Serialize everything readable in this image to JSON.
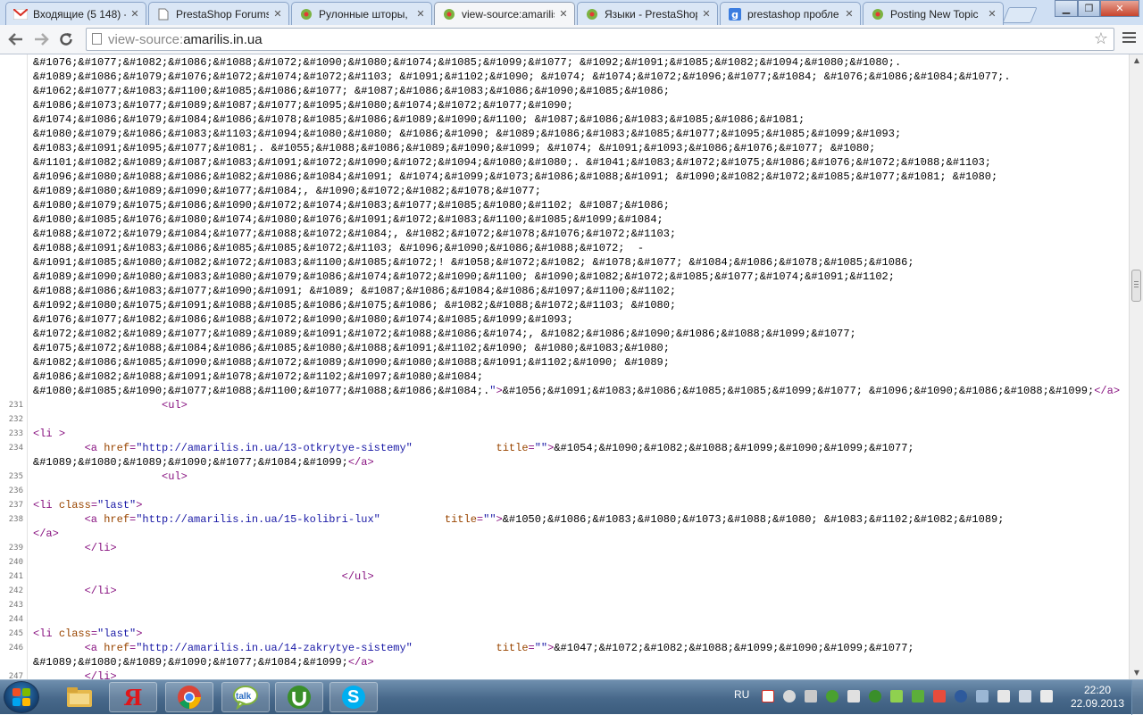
{
  "tabs": [
    {
      "title": "Входящие (5 148) -",
      "icon": "gmail-icon",
      "active": false
    },
    {
      "title": "PrestaShop Forums",
      "icon": "page-icon",
      "active": false
    },
    {
      "title": "Рулонные шторы,",
      "icon": "shop-icon",
      "active": false
    },
    {
      "title": "view-source:amarilis",
      "icon": "page-icon",
      "active": true
    },
    {
      "title": "Языки - PrestaShop",
      "icon": "shop-icon",
      "active": false
    },
    {
      "title": "prestashop пробле",
      "icon": "google-icon",
      "active": false
    },
    {
      "title": "Posting New Topic",
      "icon": "shop-icon",
      "active": false
    }
  ],
  "omnibox": {
    "prefix": "view-source:",
    "host": "amarilis.in.ua"
  },
  "source": {
    "lines": [
      {
        "n": "",
        "parts": [
          {
            "c": "e",
            "t": "&#1076;&#1077;&#1082;&#1086;&#1088;&#1072;&#1090;&#1080;&#1074;&#1085;&#1099;&#1077; &#1092;&#1091;&#1085;&#1082;&#1094;&#1080;&#1080;."
          }
        ]
      },
      {
        "n": "",
        "parts": [
          {
            "c": "e",
            "t": "&#1089;&#1086;&#1079;&#1076;&#1072;&#1074;&#1072;&#1103; &#1091;&#1102;&#1090; &#1074; &#1074;&#1072;&#1096;&#1077;&#1084; &#1076;&#1086;&#1084;&#1077;."
          }
        ]
      },
      {
        "n": "",
        "parts": [
          {
            "c": "e",
            "t": "&#1062;&#1077;&#1083;&#1100;&#1085;&#1086;&#1077; &#1087;&#1086;&#1083;&#1086;&#1090;&#1085;&#1086;"
          }
        ]
      },
      {
        "n": "",
        "parts": [
          {
            "c": "e",
            "t": "&#1086;&#1073;&#1077;&#1089;&#1087;&#1077;&#1095;&#1080;&#1074;&#1072;&#1077;&#1090;"
          }
        ]
      },
      {
        "n": "",
        "parts": [
          {
            "c": "e",
            "t": "&#1074;&#1086;&#1079;&#1084;&#1086;&#1078;&#1085;&#1086;&#1089;&#1090;&#1100; &#1087;&#1086;&#1083;&#1085;&#1086;&#1081;"
          }
        ]
      },
      {
        "n": "",
        "parts": [
          {
            "c": "e",
            "t": "&#1080;&#1079;&#1086;&#1083;&#1103;&#1094;&#1080;&#1080; &#1086;&#1090; &#1089;&#1086;&#1083;&#1085;&#1077;&#1095;&#1085;&#1099;&#1093;"
          }
        ]
      },
      {
        "n": "",
        "parts": [
          {
            "c": "e",
            "t": "&#1083;&#1091;&#1095;&#1077;&#1081;. &#1055;&#1088;&#1086;&#1089;&#1090;&#1099; &#1074; &#1091;&#1093;&#1086;&#1076;&#1077; &#1080;"
          }
        ]
      },
      {
        "n": "",
        "parts": [
          {
            "c": "e",
            "t": "&#1101;&#1082;&#1089;&#1087;&#1083;&#1091;&#1072;&#1090;&#1072;&#1094;&#1080;&#1080;. &#1041;&#1083;&#1072;&#1075;&#1086;&#1076;&#1072;&#1088;&#1103;"
          }
        ]
      },
      {
        "n": "",
        "parts": [
          {
            "c": "e",
            "t": "&#1096;&#1080;&#1088;&#1086;&#1082;&#1086;&#1084;&#1091; &#1074;&#1099;&#1073;&#1086;&#1088;&#1091; &#1090;&#1082;&#1072;&#1085;&#1077;&#1081; &#1080;"
          }
        ]
      },
      {
        "n": "",
        "parts": [
          {
            "c": "e",
            "t": "&#1089;&#1080;&#1089;&#1090;&#1077;&#1084;, &#1090;&#1072;&#1082;&#1078;&#1077;"
          }
        ]
      },
      {
        "n": "",
        "parts": [
          {
            "c": "e",
            "t": "&#1080;&#1079;&#1075;&#1086;&#1090;&#1072;&#1074;&#1083;&#1077;&#1085;&#1080;&#1102; &#1087;&#1086;"
          }
        ]
      },
      {
        "n": "",
        "parts": [
          {
            "c": "e",
            "t": "&#1080;&#1085;&#1076;&#1080;&#1074;&#1080;&#1076;&#1091;&#1072;&#1083;&#1100;&#1085;&#1099;&#1084;"
          }
        ]
      },
      {
        "n": "",
        "parts": [
          {
            "c": "e",
            "t": "&#1088;&#1072;&#1079;&#1084;&#1077;&#1088;&#1072;&#1084;, &#1082;&#1072;&#1078;&#1076;&#1072;&#1103;"
          }
        ]
      },
      {
        "n": "",
        "parts": [
          {
            "c": "e",
            "t": "&#1088;&#1091;&#1083;&#1086;&#1085;&#1085;&#1072;&#1103; &#1096;&#1090;&#1086;&#1088;&#1072;  -"
          }
        ]
      },
      {
        "n": "",
        "parts": [
          {
            "c": "e",
            "t": "&#1091;&#1085;&#1080;&#1082;&#1072;&#1083;&#1100;&#1085;&#1072;! &#1058;&#1072;&#1082; &#1078;&#1077; &#1084;&#1086;&#1078;&#1085;&#1086;"
          }
        ]
      },
      {
        "n": "",
        "parts": [
          {
            "c": "e",
            "t": "&#1089;&#1090;&#1080;&#1083;&#1080;&#1079;&#1086;&#1074;&#1072;&#1090;&#1100; &#1090;&#1082;&#1072;&#1085;&#1077;&#1074;&#1091;&#1102;"
          }
        ]
      },
      {
        "n": "",
        "parts": [
          {
            "c": "e",
            "t": "&#1088;&#1086;&#1083;&#1077;&#1090;&#1091; &#1089; &#1087;&#1086;&#1084;&#1086;&#1097;&#1100;&#1102;"
          }
        ]
      },
      {
        "n": "",
        "parts": [
          {
            "c": "e",
            "t": "&#1092;&#1080;&#1075;&#1091;&#1088;&#1085;&#1086;&#1075;&#1086; &#1082;&#1088;&#1072;&#1103; &#1080;"
          }
        ]
      },
      {
        "n": "",
        "parts": [
          {
            "c": "e",
            "t": "&#1076;&#1077;&#1082;&#1086;&#1088;&#1072;&#1090;&#1080;&#1074;&#1085;&#1099;&#1093;"
          }
        ]
      },
      {
        "n": "",
        "parts": [
          {
            "c": "e",
            "t": "&#1072;&#1082;&#1089;&#1077;&#1089;&#1089;&#1091;&#1072;&#1088;&#1086;&#1074;, &#1082;&#1086;&#1090;&#1086;&#1088;&#1099;&#1077;"
          }
        ]
      },
      {
        "n": "",
        "parts": [
          {
            "c": "e",
            "t": "&#1075;&#1072;&#1088;&#1084;&#1086;&#1085;&#1080;&#1088;&#1091;&#1102;&#1090; &#1080;&#1083;&#1080;"
          }
        ]
      },
      {
        "n": "",
        "parts": [
          {
            "c": "e",
            "t": "&#1082;&#1086;&#1085;&#1090;&#1088;&#1072;&#1089;&#1090;&#1080;&#1088;&#1091;&#1102;&#1090; &#1089;"
          }
        ]
      },
      {
        "n": "",
        "parts": [
          {
            "c": "e",
            "t": "&#1086;&#1082;&#1088;&#1091;&#1078;&#1072;&#1102;&#1097;&#1080;&#1084;"
          }
        ]
      },
      {
        "n": "",
        "parts": [
          {
            "c": "e",
            "t": "&#1080;&#1085;&#1090;&#1077;&#1088;&#1100;&#1077;&#1088;&#1086;&#1084;."
          },
          {
            "c": "v",
            "t": "\""
          },
          {
            "c": "t",
            "t": ">"
          },
          {
            "c": "e",
            "t": "&#1056;&#1091;&#1083;&#1086;&#1085;&#1085;&#1099;&#1077; &#1096;&#1090;&#1086;&#1088;&#1099;"
          },
          {
            "c": "t",
            "t": "</a>"
          }
        ]
      },
      {
        "n": "231",
        "parts": [
          {
            "c": "e",
            "t": "                    "
          },
          {
            "c": "t",
            "t": "<ul>"
          }
        ]
      },
      {
        "n": "232",
        "parts": []
      },
      {
        "n": "233",
        "parts": [
          {
            "c": "t",
            "t": "<li "
          },
          {
            "c": "t",
            "t": ">"
          }
        ]
      },
      {
        "n": "234",
        "parts": [
          {
            "c": "e",
            "t": "        "
          },
          {
            "c": "t",
            "t": "<a "
          },
          {
            "c": "a",
            "t": "href"
          },
          {
            "c": "t",
            "t": "="
          },
          {
            "c": "v",
            "t": "\"http://amarilis.in.ua/13-otkrytye-sistemy\""
          },
          {
            "c": "e",
            "t": "             "
          },
          {
            "c": "a",
            "t": "title"
          },
          {
            "c": "t",
            "t": "="
          },
          {
            "c": "v",
            "t": "\"\""
          },
          {
            "c": "t",
            "t": ">"
          },
          {
            "c": "e",
            "t": "&#1054;&#1090;&#1082;&#1088;&#1099;&#1090;&#1099;&#1077;"
          }
        ]
      },
      {
        "n": "",
        "parts": [
          {
            "c": "e",
            "t": "&#1089;&#1080;&#1089;&#1090;&#1077;&#1084;&#1099;"
          },
          {
            "c": "t",
            "t": "</a>"
          }
        ]
      },
      {
        "n": "235",
        "parts": [
          {
            "c": "e",
            "t": "                    "
          },
          {
            "c": "t",
            "t": "<ul>"
          }
        ]
      },
      {
        "n": "236",
        "parts": []
      },
      {
        "n": "237",
        "parts": [
          {
            "c": "t",
            "t": "<li "
          },
          {
            "c": "a",
            "t": "class"
          },
          {
            "c": "t",
            "t": "="
          },
          {
            "c": "v",
            "t": "\"last\""
          },
          {
            "c": "t",
            "t": ">"
          }
        ]
      },
      {
        "n": "238",
        "parts": [
          {
            "c": "e",
            "t": "        "
          },
          {
            "c": "t",
            "t": "<a "
          },
          {
            "c": "a",
            "t": "href"
          },
          {
            "c": "t",
            "t": "="
          },
          {
            "c": "v",
            "t": "\"http://amarilis.in.ua/15-kolibri-lux\""
          },
          {
            "c": "e",
            "t": "          "
          },
          {
            "c": "a",
            "t": "title"
          },
          {
            "c": "t",
            "t": "="
          },
          {
            "c": "v",
            "t": "\"\""
          },
          {
            "c": "t",
            "t": ">"
          },
          {
            "c": "e",
            "t": "&#1050;&#1086;&#1083;&#1080;&#1073;&#1088;&#1080; &#1083;&#1102;&#1082;&#1089;"
          }
        ]
      },
      {
        "n": "",
        "parts": [
          {
            "c": "t",
            "t": "</a>"
          }
        ]
      },
      {
        "n": "239",
        "parts": [
          {
            "c": "e",
            "t": "        "
          },
          {
            "c": "t",
            "t": "</li>"
          }
        ]
      },
      {
        "n": "240",
        "parts": []
      },
      {
        "n": "241",
        "parts": [
          {
            "c": "e",
            "t": "                                                "
          },
          {
            "c": "t",
            "t": "</ul>"
          }
        ]
      },
      {
        "n": "242",
        "parts": [
          {
            "c": "e",
            "t": "        "
          },
          {
            "c": "t",
            "t": "</li>"
          }
        ]
      },
      {
        "n": "243",
        "parts": []
      },
      {
        "n": "244",
        "parts": []
      },
      {
        "n": "245",
        "parts": [
          {
            "c": "t",
            "t": "<li "
          },
          {
            "c": "a",
            "t": "class"
          },
          {
            "c": "t",
            "t": "="
          },
          {
            "c": "v",
            "t": "\"last\""
          },
          {
            "c": "t",
            "t": ">"
          }
        ]
      },
      {
        "n": "246",
        "parts": [
          {
            "c": "e",
            "t": "        "
          },
          {
            "c": "t",
            "t": "<a "
          },
          {
            "c": "a",
            "t": "href"
          },
          {
            "c": "t",
            "t": "="
          },
          {
            "c": "v",
            "t": "\"http://amarilis.in.ua/14-zakrytye-sistemy\""
          },
          {
            "c": "e",
            "t": "             "
          },
          {
            "c": "a",
            "t": "title"
          },
          {
            "c": "t",
            "t": "="
          },
          {
            "c": "v",
            "t": "\"\""
          },
          {
            "c": "t",
            "t": ">"
          },
          {
            "c": "e",
            "t": "&#1047;&#1072;&#1082;&#1088;&#1099;&#1090;&#1099;&#1077;"
          }
        ]
      },
      {
        "n": "",
        "parts": [
          {
            "c": "e",
            "t": "&#1089;&#1080;&#1089;&#1090;&#1077;&#1084;&#1099;"
          },
          {
            "c": "t",
            "t": "</a>"
          }
        ]
      },
      {
        "n": "247",
        "parts": [
          {
            "c": "e",
            "t": "        "
          },
          {
            "c": "t",
            "t": "</li>"
          }
        ]
      }
    ]
  },
  "taskbar": {
    "apps": [
      "explorer-icon",
      "yandex-icon",
      "chrome-icon",
      "gtalk-icon",
      "utorrent-icon",
      "skype-icon"
    ],
    "yandex_label": "Я",
    "gtalk_label": "talk",
    "skype_label": "S",
    "lang": "RU",
    "time": "22:20",
    "date": "22.09.2013"
  },
  "colors": {
    "tag": "#881280",
    "attr": "#994500",
    "value": "#1a1aa6",
    "accent": "#4c73a6"
  }
}
